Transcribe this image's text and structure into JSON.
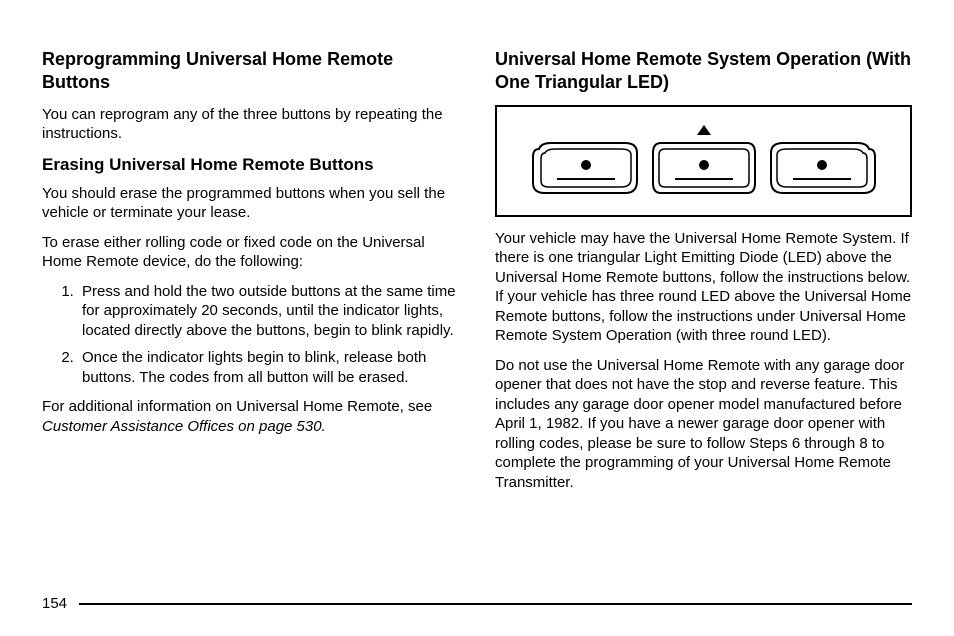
{
  "left": {
    "heading1": "Reprogramming Universal Home Remote Buttons",
    "p1": "You can reprogram any of the three buttons by repeating the instructions.",
    "heading2": "Erasing Universal Home Remote Buttons",
    "p2": "You should erase the programmed buttons when you sell the vehicle or terminate your lease.",
    "p3": "To erase either rolling code or fixed code on the Universal Home Remote device, do the following:",
    "steps": [
      "Press and hold the two outside buttons at the same time for approximately 20 seconds, until the indicator lights, located directly above the buttons, begin to blink rapidly.",
      "Once the indicator lights begin to blink, release both buttons. The codes from all button will be erased."
    ],
    "p4_pre": "For additional information on Universal Home Remote, see ",
    "p4_ref": "Customer Assistance Offices on page 530.",
    "p4_post": ""
  },
  "right": {
    "heading1": "Universal Home Remote System Operation (With One Triangular LED)",
    "p1": "Your vehicle may have the Universal Home Remote System. If there is one triangular Light Emitting Diode (LED) above the Universal Home Remote buttons, follow the instructions below. If your vehicle has three round LED above the Universal Home Remote buttons, follow the instructions under Universal Home Remote System Operation (with three round LED).",
    "p2": "Do not use the Universal Home Remote with any garage door opener that does not have the stop and reverse feature. This includes any garage door opener model manufactured before April 1, 1982. If you have a newer garage door opener with rolling codes, please be sure to follow Steps 6 through 8 to complete the programming of your Universal Home Remote Transmitter."
  },
  "page_number": "154"
}
